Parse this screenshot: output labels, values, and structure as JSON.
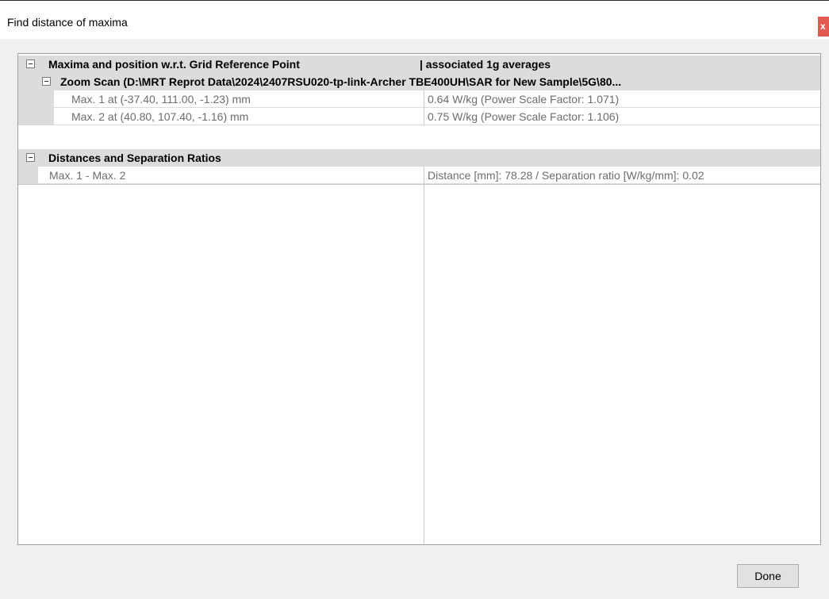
{
  "window": {
    "title": "Find distance of maxima",
    "close_label": "x"
  },
  "tree": {
    "maxima_header": {
      "label": "Maxima and position w.r.t. Grid Reference Point",
      "column2": "|  associated 1g averages"
    },
    "zoom_scan": {
      "label": "Zoom Scan (D:\\MRT Reprot Data\\2024\\2407RSU020-tp-link-Archer TBE400UH\\SAR for New Sample\\5G\\80..."
    },
    "maxima": [
      {
        "position": "Max. 1 at (-37.40, 111.00, -1.23) mm",
        "average": "0.64 W/kg (Power Scale Factor: 1.071)"
      },
      {
        "position": "Max. 2 at (40.80, 107.40, -1.16) mm",
        "average": "0.75 W/kg (Power Scale Factor: 1.106)"
      }
    ],
    "distances_header": {
      "label": "Distances and Separation Ratios"
    },
    "distances": [
      {
        "pair": "Max. 1 - Max. 2",
        "value": "Distance [mm]: 78.28 / Separation ratio [W/kg/mm]: 0.02"
      }
    ]
  },
  "footer": {
    "done_label": "Done"
  }
}
